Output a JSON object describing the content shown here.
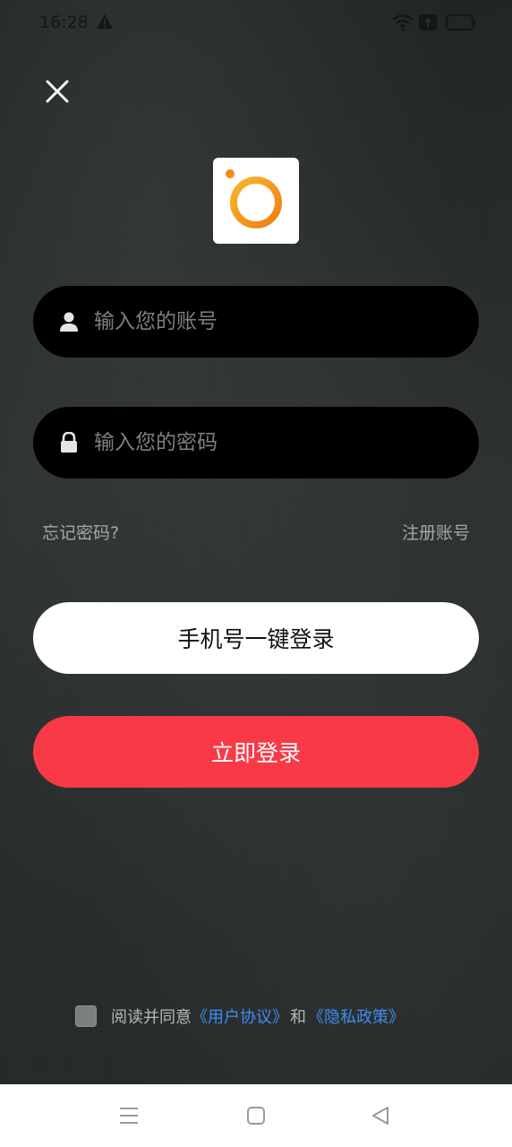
{
  "status_bar": {
    "time": "16:28",
    "icons": [
      "warning-icon",
      "wifi-icon",
      "sim-icon",
      "battery-icon"
    ]
  },
  "header": {
    "close_icon": "close-icon",
    "logo_icon": "app-logo-ring"
  },
  "form": {
    "account": {
      "placeholder": "输入您的账号",
      "value": "",
      "icon": "user-icon"
    },
    "password": {
      "placeholder": "输入您的密码",
      "value": "",
      "icon": "lock-icon"
    },
    "forgot_label": "忘记密码?",
    "register_label": "注册账号"
  },
  "buttons": {
    "phone_login_label": "手机号一键登录",
    "login_label": "立即登录"
  },
  "agreement": {
    "checked": false,
    "prefix": "阅读并同意",
    "user_agreement": "《用户协议》",
    "and": "和",
    "privacy_policy": "《隐私政策》"
  },
  "nav": {
    "icons": [
      "menu-icon",
      "home-icon",
      "back-icon"
    ]
  },
  "colors": {
    "login_button": "#f93a46",
    "link": "#3d8df5",
    "logo_ring": "#f39a1e",
    "input_bg": "#000000"
  }
}
